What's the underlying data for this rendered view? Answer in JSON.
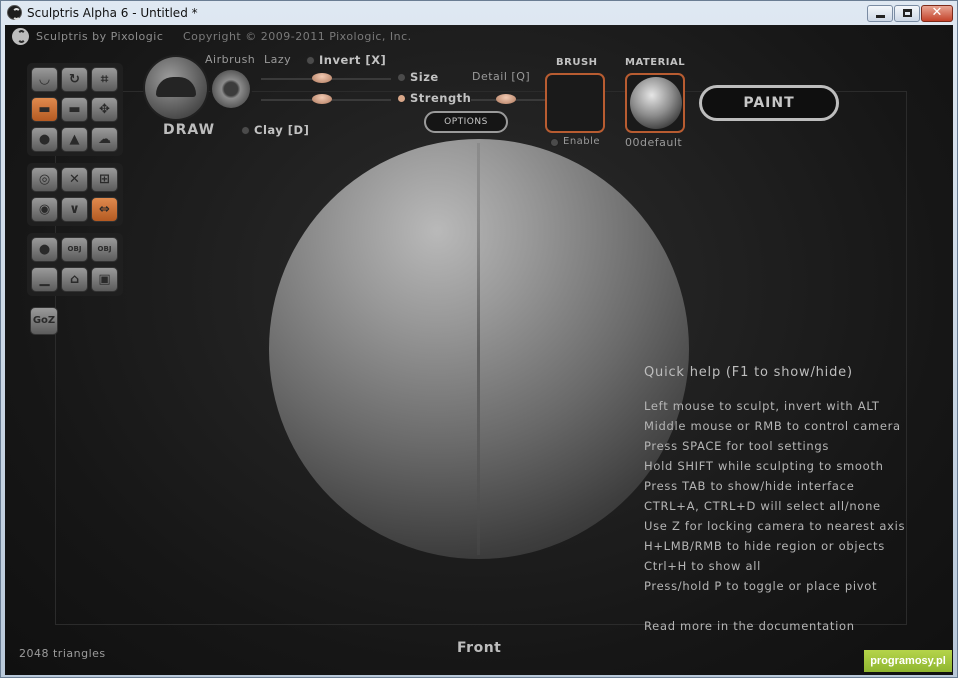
{
  "window": {
    "title": "Sculptris Alpha 6 - Untitled *",
    "min_glyph": "",
    "max_glyph": "",
    "close_glyph": "✕"
  },
  "app": {
    "name": "Sculptris by Pixologic",
    "copyright": "Copyright © 2009-2011 Pixologic, Inc."
  },
  "toolbar": {
    "draw_label": "DRAW",
    "airbrush_label": "Airbrush",
    "lazy_label": "Lazy",
    "invert_label": "Invert [X]",
    "size_label": "Size",
    "strength_label": "Strength",
    "detail_label": "Detail [Q]",
    "clay_label": "Clay [D]",
    "options_label": "OPTIONS",
    "brush_title": "BRUSH",
    "brush_enable_label": "Enable",
    "material_title": "MATERIAL",
    "material_name": "00default",
    "paint_label": "PAINT"
  },
  "tools": {
    "goz_label": "GoZ",
    "obj_label": "OBJ"
  },
  "quickhelp": {
    "title": "Quick help (F1 to show/hide)",
    "lines": [
      "Left mouse to sculpt, invert with ALT",
      "Middle mouse or RMB to control camera",
      "Press SPACE for tool settings",
      "Hold SHIFT while sculpting to smooth",
      "Press TAB to show/hide interface",
      "CTRL+A, CTRL+D will select all/none",
      "Use Z for locking camera to nearest axis",
      "H+LMB/RMB to hide region or objects",
      "Ctrl+H to show all",
      "Press/hold P to toggle or place pivot"
    ],
    "more": "Read more in the documentation"
  },
  "status": {
    "triangles": "2048 triangles",
    "view": "Front"
  },
  "watermark": "programosy.pl",
  "colors": {
    "accent": "#c8692f",
    "knob": "#d9a789"
  }
}
